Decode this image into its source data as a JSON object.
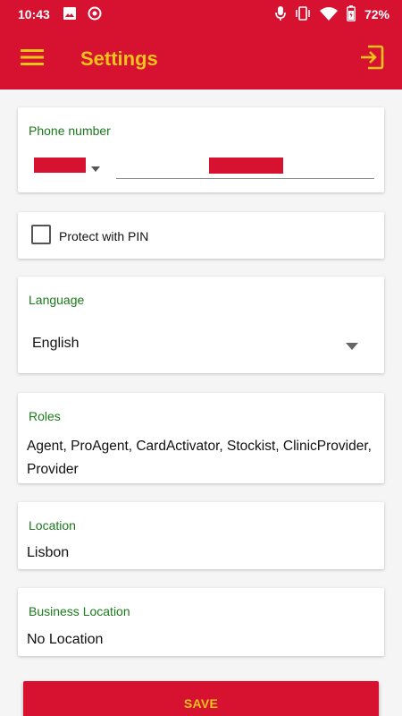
{
  "status_bar": {
    "time": "10:43",
    "battery": "72%"
  },
  "app_bar": {
    "title": "Settings"
  },
  "phone": {
    "label": "Phone number"
  },
  "pin": {
    "label": "Protect with PIN",
    "checked": false
  },
  "language": {
    "label": "Language",
    "value": "English"
  },
  "roles": {
    "label": "Roles",
    "value": "Agent, ProAgent, CardActivator, Stockist, ClinicProvider, Provider"
  },
  "location": {
    "label": "Location",
    "value": "Lisbon"
  },
  "business_location": {
    "label": "Business Location",
    "value": "No Location"
  },
  "save_button": {
    "label": "SAVE"
  },
  "colors": {
    "primary": "#d61230",
    "accent": "#f2c31b",
    "label_green": "#1b7a1b"
  }
}
